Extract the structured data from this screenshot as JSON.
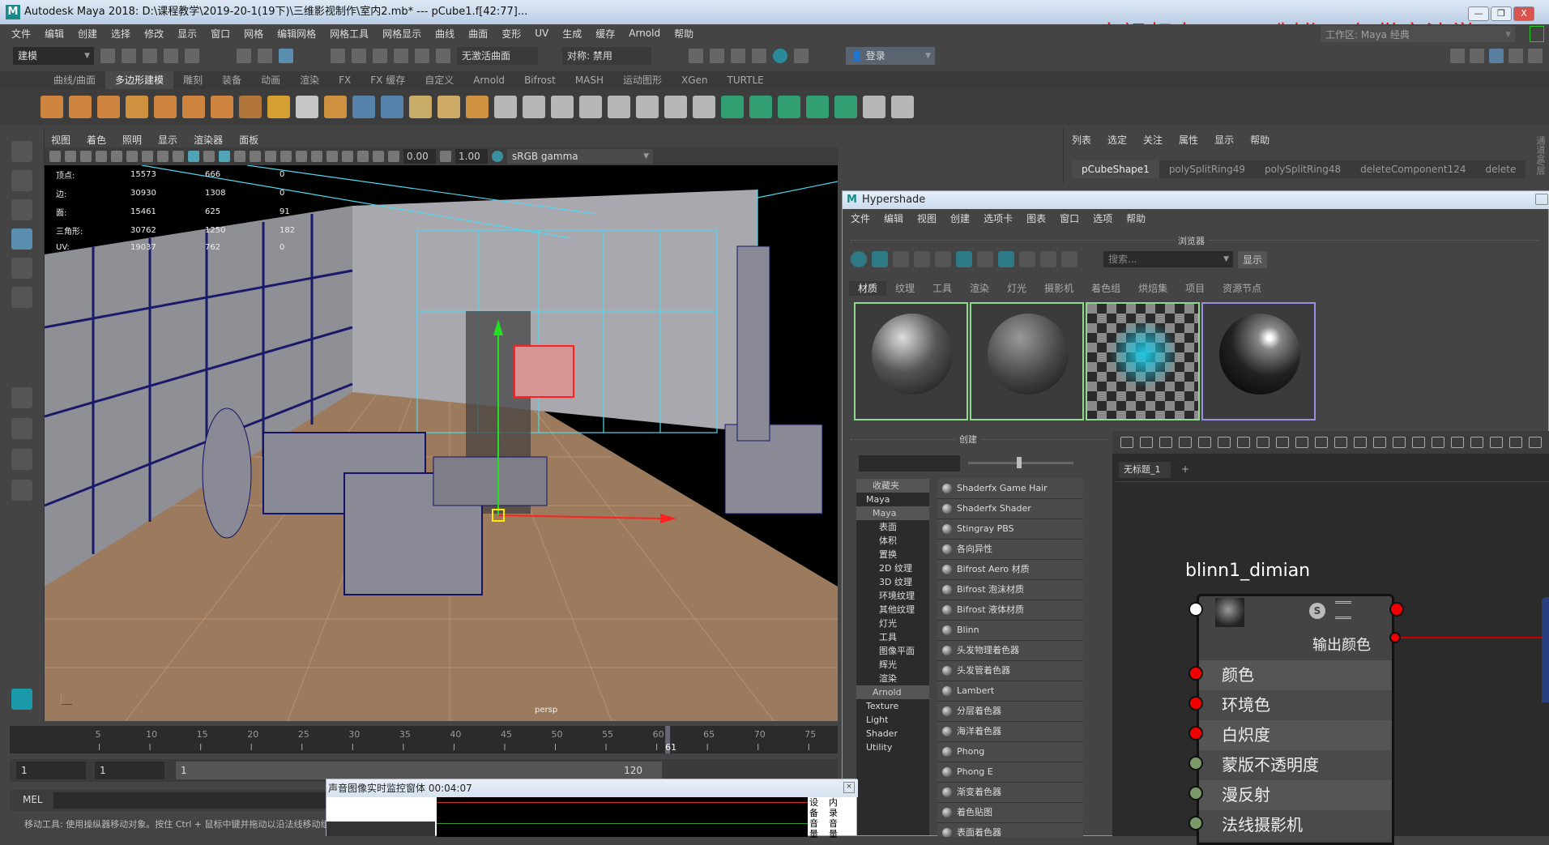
{
  "titlebar": {
    "title": "Autodesk Maya 2018: D:\\课程教学\\2019-20-1(19下)\\三维影视制作\\室内2.mb*   ---   pCube1.f[42:77]...",
    "logo": "M"
  },
  "watermark": "本视频由Brook制作，仅供交流学习。",
  "workspace": "工作区: Maya 经典",
  "menubar": [
    "文件",
    "编辑",
    "创建",
    "选择",
    "修改",
    "显示",
    "窗口",
    "网格",
    "编辑网格",
    "网格工具",
    "网格显示",
    "曲线",
    "曲面",
    "变形",
    "UV",
    "生成",
    "缓存",
    "Arnold",
    "帮助"
  ],
  "statusline": {
    "mode": "建模",
    "live_surface": "无激活曲面",
    "symmetry": "对称: 禁用",
    "login": "登录"
  },
  "shelf_tabs": [
    "曲线/曲面",
    "多边形建模",
    "雕刻",
    "装备",
    "动画",
    "渲染",
    "FX",
    "FX 缓存",
    "自定义",
    "Arnold",
    "Bifrost",
    "MASH",
    "运动图形",
    "XGen",
    "TURTLE"
  ],
  "shelf_active": "多边形建模",
  "shelf_icons": [
    "sphere",
    "cube",
    "cylinder",
    "cone",
    "torus",
    "plane",
    "disc",
    "platonic",
    "super-shape",
    "text",
    "svg",
    "combine",
    "separate",
    "smooth",
    "extract",
    "bevel",
    "bridge",
    "extrude",
    "append",
    "fill-hole",
    "make-hole",
    "multi-cut",
    "insert-edge-loop",
    "offset-edge-loop",
    "target-weld",
    "connect",
    "planar-uv",
    "automatic-uv",
    "uv-editor",
    "mirror",
    "quad-draw"
  ],
  "viewport": {
    "menu": [
      "视图",
      "着色",
      "照明",
      "显示",
      "渲染器",
      "面板"
    ],
    "exposure": "0.00",
    "gamma": "1.00",
    "colorspace": "sRGB gamma",
    "camera": "persp",
    "hud": [
      [
        "顶点:",
        "15573",
        "666",
        "0"
      ],
      [
        "边:",
        "30930",
        "1308",
        "0"
      ],
      [
        "面:",
        "15461",
        "625",
        "91"
      ],
      [
        "三角形:",
        "30762",
        "1250",
        "182"
      ],
      [
        "UV:",
        "19037",
        "762",
        "0"
      ]
    ]
  },
  "channelbox": {
    "menu": [
      "列表",
      "选定",
      "关注",
      "属性",
      "显示",
      "帮助"
    ],
    "tabs": [
      "pCubeShape1",
      "polySplitRing49",
      "polySplitRing48",
      "deleteComponent124",
      "delete"
    ],
    "side_label": "通道盒/层"
  },
  "hypershade": {
    "title": "Hypershade",
    "logo": "M",
    "menu": [
      "文件",
      "编辑",
      "视图",
      "创建",
      "选项卡",
      "图表",
      "窗口",
      "选项",
      "帮助"
    ],
    "browser_label": "浏览器",
    "search_placeholder": "搜索...",
    "show_button": "显示",
    "tabs": [
      "材质",
      "纹理",
      "工具",
      "渲染",
      "灯光",
      "摄影机",
      "着色组",
      "烘焙集",
      "项目",
      "资源节点"
    ],
    "create_label": "创建",
    "tree": [
      {
        "label": "收藏夹",
        "type": "hdr"
      },
      {
        "label": "Maya",
        "type": "sub"
      },
      {
        "label": "Maya",
        "type": "hdr"
      },
      {
        "label": "表面"
      },
      {
        "label": "体积"
      },
      {
        "label": "置换"
      },
      {
        "label": "2D 纹理"
      },
      {
        "label": "3D 纹理"
      },
      {
        "label": "环境纹理"
      },
      {
        "label": "其他纹理"
      },
      {
        "label": "灯光"
      },
      {
        "label": "工具"
      },
      {
        "label": "图像平面"
      },
      {
        "label": "辉光"
      },
      {
        "label": "渲染"
      },
      {
        "label": "Arnold",
        "type": "hdr"
      },
      {
        "label": "Texture",
        "type": "sub"
      },
      {
        "label": "Light",
        "type": "sub"
      },
      {
        "label": "Shader",
        "type": "sub"
      },
      {
        "label": "Utility",
        "type": "sub"
      }
    ],
    "shaders": [
      "Shaderfx Game Hair",
      "Shaderfx Shader",
      "Stingray PBS",
      "各向异性",
      "Bifrost Aero 材质",
      "Bifrost 泡沫材质",
      "Bifrost 液体材质",
      "Blinn",
      "头发物理着色器",
      "头发管着色器",
      "Lambert",
      "分层着色器",
      "海洋着色器",
      "Phong",
      "Phong E",
      "渐变着色器",
      "着色贴图",
      "表面着色器"
    ],
    "node_tab": "无标题_1",
    "node_tab_add": "+",
    "node": {
      "name": "blinn1_dimian",
      "output": "输出颜色",
      "attrs": [
        "颜色",
        "环境色",
        "白炽度",
        "蒙版不透明度",
        "漫反射",
        "法线摄影机"
      ]
    }
  },
  "timeline": {
    "ticks": [
      5,
      10,
      15,
      20,
      25,
      30,
      35,
      40,
      45,
      50,
      55,
      60,
      65,
      70,
      75
    ],
    "current": "61"
  },
  "range": {
    "start": "1",
    "anim_start": "1",
    "slider_start": "1",
    "slider_end": "120"
  },
  "mel": {
    "label": "MEL"
  },
  "help_line": "移动工具: 使用操纵器移动对象。按住 Ctrl + 鼠标中键并拖动以沿法线移动组",
  "monitor": {
    "title": "声音图像实时监控窗体 00:04:07",
    "device": "设备音量",
    "internal": "内录音量"
  }
}
